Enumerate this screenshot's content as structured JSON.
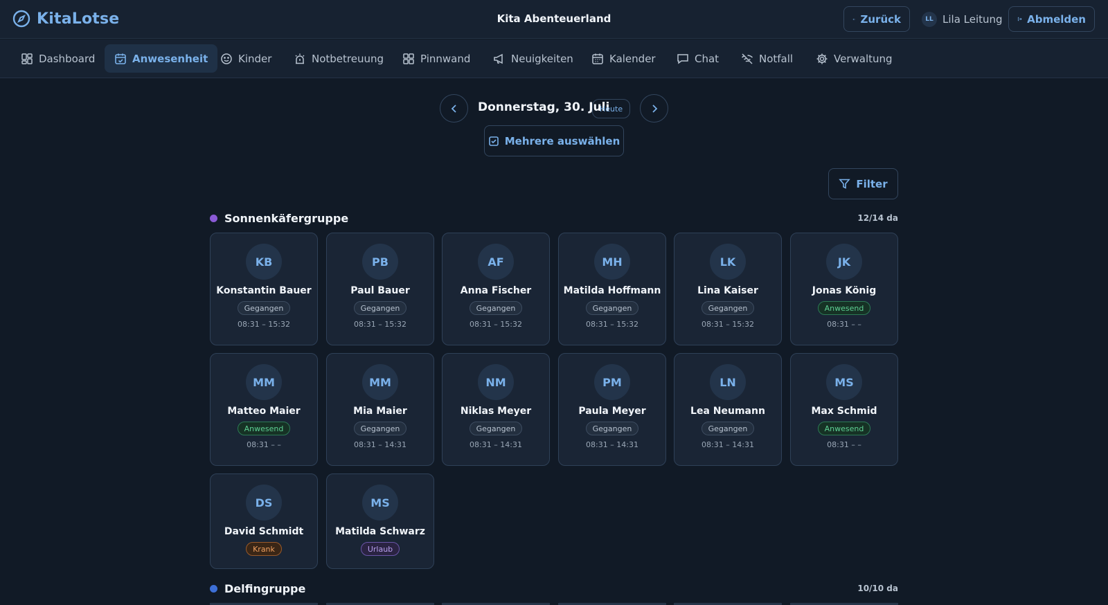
{
  "app": {
    "name": "KitaLotse",
    "site": "Kita Abenteuerland"
  },
  "header": {
    "back_label": "Zurück",
    "user_initials": "LL",
    "user_name": "Lila Leitung",
    "logout_label": "Abmelden"
  },
  "nav": [
    {
      "label": "Dashboard",
      "icon": "dashboard-icon"
    },
    {
      "label": "Anwesenheit",
      "icon": "calendar-check-icon",
      "active": true
    },
    {
      "label": "Kinder",
      "icon": "smiley-icon"
    },
    {
      "label": "Notbetreuung",
      "icon": "siren-icon"
    },
    {
      "label": "Pinnwand",
      "icon": "grid-icon"
    },
    {
      "label": "Neuigkeiten",
      "icon": "megaphone-icon"
    },
    {
      "label": "Kalender",
      "icon": "calendar-icon"
    },
    {
      "label": "Chat",
      "icon": "chat-icon"
    },
    {
      "label": "Notfall",
      "icon": "wifi-off-icon"
    },
    {
      "label": "Verwaltung",
      "icon": "gear-icon"
    }
  ],
  "day": {
    "date": "Donnerstag, 30. Juli",
    "today_label": "Heute",
    "multi_select_label": "Mehrere auswählen",
    "filter_label": "Filter"
  },
  "groups": [
    {
      "name": "Sonnenkäfergruppe",
      "count": "12/14 da",
      "color": "#8a5ad6",
      "children": [
        {
          "initials": "KB",
          "name": "Konstantin Bauer",
          "status": "Gegangen",
          "time": "08:31 – 15:32"
        },
        {
          "initials": "PB",
          "name": "Paul Bauer",
          "status": "Gegangen",
          "time": "08:31 – 15:32"
        },
        {
          "initials": "AF",
          "name": "Anna Fischer",
          "status": "Gegangen",
          "time": "08:31 – 15:32"
        },
        {
          "initials": "MH",
          "name": "Matilda Hoffmann",
          "status": "Gegangen",
          "time": "08:31 – 15:32"
        },
        {
          "initials": "LK",
          "name": "Lina Kaiser",
          "status": "Gegangen",
          "time": "08:31 – 15:32"
        },
        {
          "initials": "JK",
          "name": "Jonas König",
          "status": "Anwesend",
          "time": "08:31 – –"
        },
        {
          "initials": "MM",
          "name": "Matteo Maier",
          "status": "Anwesend",
          "time": "08:31 – –"
        },
        {
          "initials": "MM",
          "name": "Mia Maier",
          "status": "Gegangen",
          "time": "08:31 – 14:31"
        },
        {
          "initials": "NM",
          "name": "Niklas Meyer",
          "status": "Gegangen",
          "time": "08:31 – 14:31"
        },
        {
          "initials": "PM",
          "name": "Paula Meyer",
          "status": "Gegangen",
          "time": "08:31 – 14:31"
        },
        {
          "initials": "LN",
          "name": "Lea Neumann",
          "status": "Gegangen",
          "time": "08:31 – 14:31"
        },
        {
          "initials": "MS",
          "name": "Max Schmid",
          "status": "Anwesend",
          "time": "08:31 – –"
        },
        {
          "initials": "DS",
          "name": "David Schmidt",
          "status": "Krank",
          "time": ""
        },
        {
          "initials": "MS",
          "name": "Matilda Schwarz",
          "status": "Urlaub",
          "time": ""
        }
      ]
    },
    {
      "name": "Delfingruppe",
      "count": "10/10 da",
      "color": "#3d6fd6",
      "children": []
    }
  ],
  "colors": {
    "accent": "#7ab1ea",
    "present": "#5ed194",
    "sick": "#f0a060",
    "vacation": "#b9a0f0"
  }
}
